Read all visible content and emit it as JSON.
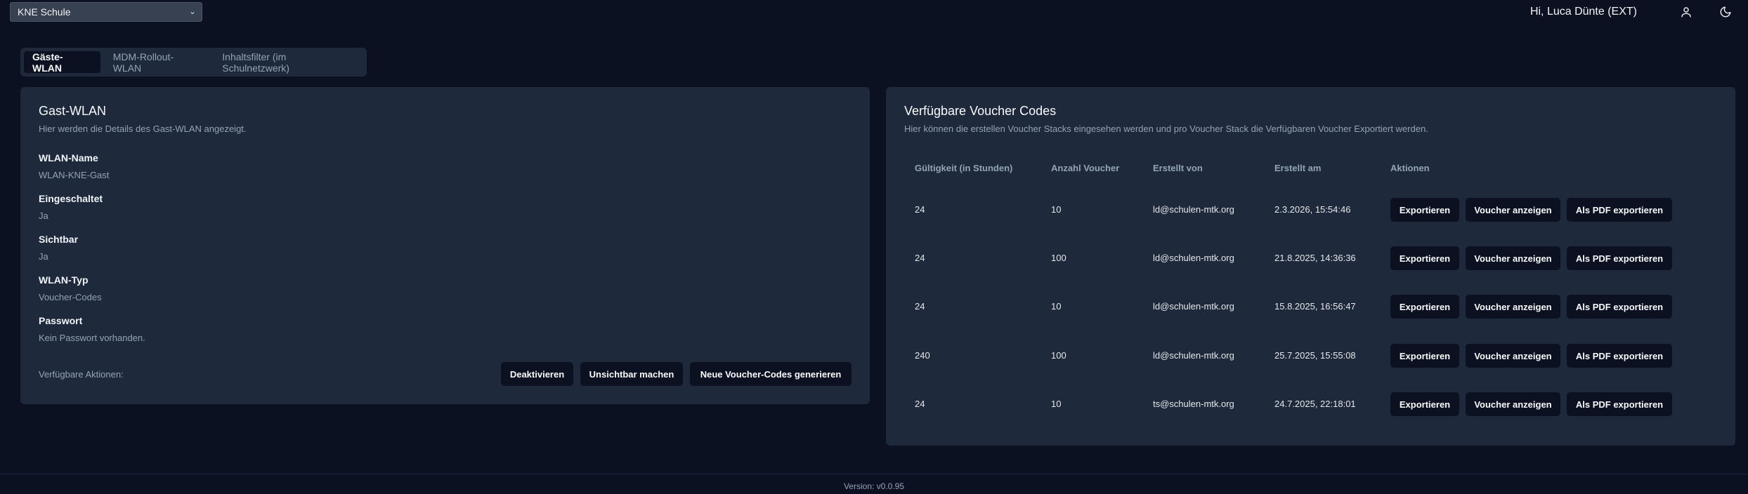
{
  "header": {
    "school_select": "KNE Schule",
    "greeting": "Hi, Luca Dünte (EXT)",
    "user_icon": "user-icon",
    "theme_icon": "moon-icon"
  },
  "tabs": [
    {
      "label": "Gäste-WLAN",
      "active": true
    },
    {
      "label": "MDM-Rollout-WLAN",
      "active": false
    },
    {
      "label": "Inhaltsfilter (im Schulnetzwerk)",
      "active": false
    }
  ],
  "guest_wlan": {
    "title": "Gast-WLAN",
    "subtitle": "Hier werden die Details des Gast-WLAN angezeigt.",
    "fields": [
      {
        "label": "WLAN-Name",
        "value": "WLAN-KNE-Gast"
      },
      {
        "label": "Eingeschaltet",
        "value": "Ja"
      },
      {
        "label": "Sichtbar",
        "value": "Ja"
      },
      {
        "label": "WLAN-Typ",
        "value": "Voucher-Codes"
      },
      {
        "label": "Passwort",
        "value": "Kein Passwort vorhanden."
      }
    ],
    "actions_label": "Verfügbare Aktionen:",
    "buttons": {
      "deactivate": "Deaktivieren",
      "hide": "Unsichtbar machen",
      "generate": "Neue Voucher-Codes generieren"
    }
  },
  "vouchers": {
    "title": "Verfügbare Voucher Codes",
    "subtitle": "Hier können die erstellen Voucher Stacks eingesehen werden und pro Voucher Stack die Verfügbaren Voucher Exportiert werden.",
    "columns": [
      "Gültigkeit (in Stunden)",
      "Anzahl Voucher",
      "Erstellt von",
      "Erstellt am",
      "Aktionen"
    ],
    "rows": [
      {
        "validity": "24",
        "count": "10",
        "creator": "ld@schulen-mtk.org",
        "created": "2.3.2026, 15:54:46"
      },
      {
        "validity": "24",
        "count": "100",
        "creator": "ld@schulen-mtk.org",
        "created": "21.8.2025, 14:36:36"
      },
      {
        "validity": "24",
        "count": "10",
        "creator": "ld@schulen-mtk.org",
        "created": "15.8.2025, 16:56:47"
      },
      {
        "validity": "240",
        "count": "100",
        "creator": "ld@schulen-mtk.org",
        "created": "25.7.2025, 15:55:08"
      },
      {
        "validity": "24",
        "count": "10",
        "creator": "ts@schulen-mtk.org",
        "created": "24.7.2025, 22:18:01"
      }
    ],
    "row_buttons": {
      "export": "Exportieren",
      "show": "Voucher anzeigen",
      "pdf": "Als PDF exportieren"
    }
  },
  "footer": {
    "version": "Version: v0.0.95"
  }
}
